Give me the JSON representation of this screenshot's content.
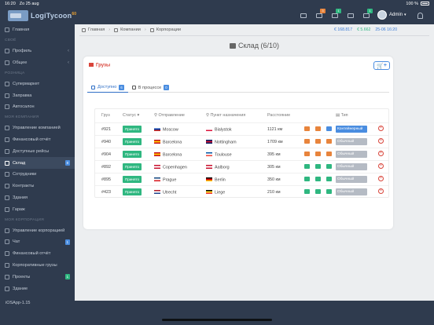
{
  "status": {
    "time": "16:20",
    "date": "Zo 25 aug",
    "battery": "100 %"
  },
  "app": {
    "logo_main": "LogiTycoon",
    "logo_badge": "60"
  },
  "top": {
    "icons": [
      {
        "name": "calculator-icon",
        "badge": ""
      },
      {
        "name": "bell-icon",
        "badge": "3",
        "color": "#e8843c"
      },
      {
        "name": "check-icon",
        "badge": "1",
        "color": "#2fb780"
      },
      {
        "name": "truck-icon",
        "badge": ""
      },
      {
        "name": "inbox-icon",
        "badge": "1",
        "color": "#2fb780"
      }
    ],
    "user": "Admin",
    "money1": "€ 168.817",
    "money2": "€ 5.662",
    "datetime": "25-06 16:20"
  },
  "sidebar": {
    "items": [
      {
        "label": "Главная",
        "icon": "home-icon"
      },
      {
        "section": "СВОЁ"
      },
      {
        "label": "Профиль",
        "icon": "user-icon",
        "chev": "‹"
      },
      {
        "label": "Общее",
        "icon": "info-icon",
        "chev": "‹"
      },
      {
        "section": "РОЗНИЦА"
      },
      {
        "label": "Супермаркет",
        "icon": "shop-icon"
      },
      {
        "label": "Заправка",
        "icon": "fuel-icon"
      },
      {
        "label": "Автосалон",
        "icon": "car-icon"
      },
      {
        "section": "МОЯ КОМПАНИЯ"
      },
      {
        "label": "Управление компанией",
        "icon": "settings-icon"
      },
      {
        "label": "Финансовый отчёт",
        "icon": "report-icon"
      },
      {
        "label": "Доступные рейсы",
        "icon": "route-icon"
      },
      {
        "label": "Склад",
        "icon": "warehouse-icon",
        "badge": "8",
        "active": true
      },
      {
        "label": "Сотрудники",
        "icon": "people-icon"
      },
      {
        "label": "Контракты",
        "icon": "contract-icon"
      },
      {
        "label": "Здания",
        "icon": "building-icon"
      },
      {
        "label": "Гараж",
        "icon": "garage-icon"
      },
      {
        "section": "МОЯ КОРПОРАЦИЯ"
      },
      {
        "label": "Управление корпорацией",
        "icon": "settings-icon"
      },
      {
        "label": "Чат",
        "icon": "chat-icon",
        "badge": "1"
      },
      {
        "label": "Финансовый отчёт",
        "icon": "report-icon"
      },
      {
        "label": "Корпоративные грузы",
        "icon": "cargo-icon"
      },
      {
        "label": "Проекты",
        "icon": "project-icon",
        "badge": "1",
        "badge_green": true
      },
      {
        "label": "Здание",
        "icon": "building-icon"
      }
    ],
    "version": "iOSApp-1.15"
  },
  "breadcrumb": [
    "Главная",
    "Компании",
    "Корпорации"
  ],
  "page_title": "Склад (6/10)",
  "card": {
    "title": "Грузы",
    "cart_button": "+",
    "tabs": [
      {
        "label": "Доступно",
        "badge": "6",
        "active": true
      },
      {
        "label": "В процессе",
        "badge": "0"
      }
    ]
  },
  "table": {
    "headers": {
      "cargo": "Груз",
      "status": "Статус",
      "origin": "Отправление",
      "destination": "Пункт назначения",
      "distance": "Расстояние",
      "type": "Тип"
    },
    "rows": [
      {
        "id": "#921",
        "status": "Принято",
        "origin": "Moscow",
        "origin_flag": [
          "#ffffff",
          "#0039a6",
          "#d52b1e"
        ],
        "dest": "Bialystok",
        "dest_flag": [
          "#ffffff",
          "#ffffff",
          "#dc143c"
        ],
        "distance": "1121 км",
        "type": "Контейнерный",
        "type_kind": "cont",
        "icons": [
          "#e8843c",
          "#e8843c",
          "#4a8de0"
        ]
      },
      {
        "id": "#940",
        "status": "Принято",
        "origin": "Barcelona",
        "origin_flag": [
          "#c60b1e",
          "#ffc400",
          "#c60b1e"
        ],
        "dest": "Nottingham",
        "dest_flag": [
          "#012169",
          "#c8102e",
          "#012169"
        ],
        "distance": "1709 км",
        "type": "Обычный",
        "type_kind": "norm",
        "icons": [
          "#e8843c",
          "#e8843c",
          "#e8843c"
        ]
      },
      {
        "id": "#904",
        "status": "Принято",
        "origin": "Barcelona",
        "origin_flag": [
          "#c60b1e",
          "#ffc400",
          "#c60b1e"
        ],
        "dest": "Toulouse",
        "dest_flag": [
          "#0055a4",
          "#ffffff",
          "#ef4135"
        ],
        "distance": "395 км",
        "type": "Обычный",
        "type_kind": "norm",
        "icons": [
          "#e8843c",
          "#e8843c",
          "#e8843c"
        ]
      },
      {
        "id": "#892",
        "status": "Принято",
        "origin": "Copenhagen",
        "origin_flag": [
          "#c8102e",
          "#ffffff",
          "#c8102e"
        ],
        "dest": "Aalborg",
        "dest_flag": [
          "#c8102e",
          "#ffffff",
          "#c8102e"
        ],
        "distance": "305 км",
        "type": "Обычный",
        "type_kind": "norm",
        "icons": [
          "#2fb780",
          "#2fb780",
          "#2fb780"
        ]
      },
      {
        "id": "#895",
        "status": "Принято",
        "origin": "Prague",
        "origin_flag": [
          "#11457e",
          "#ffffff",
          "#d7141a"
        ],
        "dest": "Berlin",
        "dest_flag": [
          "#000000",
          "#dd0000",
          "#ffce00"
        ],
        "distance": "350 км",
        "type": "Обычный",
        "type_kind": "norm",
        "icons": [
          "#2fb780",
          "#2fb780",
          "#2fb780"
        ]
      },
      {
        "id": "#423",
        "status": "Принято",
        "origin": "Utrecht",
        "origin_flag": [
          "#ae1c28",
          "#ffffff",
          "#21468b"
        ],
        "dest": "Liege",
        "dest_flag": [
          "#000000",
          "#fdda24",
          "#ef3340"
        ],
        "distance": "210 км",
        "type": "Обычный",
        "type_kind": "norm",
        "icons": [
          "#2fb780",
          "#2fb780",
          "#2fb780"
        ]
      }
    ]
  }
}
